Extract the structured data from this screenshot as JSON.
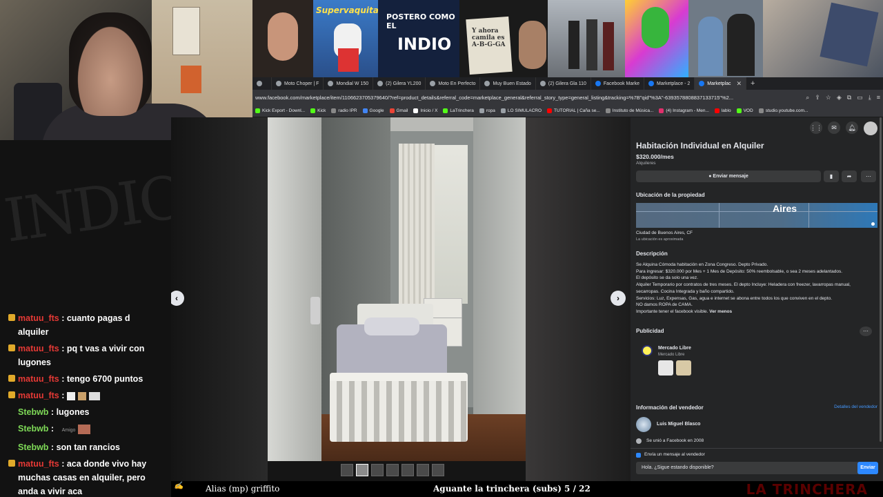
{
  "tabs": [
    {
      "label": "Moto Choper | F"
    },
    {
      "label": "Mondial W 150"
    },
    {
      "label": "(2) Gilera YL200"
    },
    {
      "label": "Moto En Perfecto"
    },
    {
      "label": "Muy Buen Estado"
    },
    {
      "label": "(2) Gilera Gla 110"
    },
    {
      "label": "Facebook Marke"
    },
    {
      "label": "Marketplace - 2"
    },
    {
      "label": "Marketplac"
    }
  ],
  "address_url": "www.facebook.com/marketplace/item/1106623705379640/?ref=product_details&referral_code=marketplace_general&referral_story_type=general_listing&tracking=%7B\"qid\"%3A\"-6393578808837133715\"%2...",
  "bookmarks": [
    "Kick Export - Downl...",
    "Kick",
    "radio IPR",
    "Google",
    "Gmail",
    "Inicio / X",
    "LaTrinchera",
    "ropa",
    "LO SIMULACRO",
    "TUTORIAL | Caña se...",
    "Instituto de Música...",
    "(4) Instagram - Men...",
    "lablo",
    "VOD",
    "studio.youtube.com..."
  ],
  "thumbs": {
    "supervaquita": "Supervaquita",
    "indio": "INDIO",
    "note": "Y ahora camila es A-B-G-GA",
    "posterito": "POSTERO COMO EL"
  },
  "listing": {
    "title": "Habitación Individual en Alquiler",
    "price": "$320.000/mes",
    "category": "Alquileres",
    "send_message": "Enviar mensaje",
    "location_title": "Ubicación de la propiedad",
    "map_label": "Aires",
    "city": "Ciudad de Buenos Aires, CF",
    "approx": "La ubicación es aproximada",
    "description_title": "Descripción",
    "description_lines": [
      "Se Alquina Cómoda habitación en Zona Congreso. Depto Privado.",
      "Para ingresar: $320.000 por Mes + 1 Mes de Depósito: 50% reembolsable, o sea 2 meses adelantados.",
      "El depósito se da solo una vez.",
      "Alquiler Temporario por contratos de tres meses. El depto Incluye: Heladera con freezer, lavarropas manual,",
      "secarropas. Cocina Integrada y baño compartido.",
      "Servicios: Luz, Expensas, Gas, agua e internet se abona entre todos los que conviven en el depto.",
      "NO damos ROPA de CAMA.",
      "Importante tener el facebook visible."
    ],
    "see_less": "Ver menos",
    "ads_title": "Publicidad",
    "ad_name": "Mercado Libre",
    "ad_sub": "Mercado Libre",
    "seller_info_title": "Información del vendedor",
    "seller_details": "Detalles del vendedor",
    "seller_name": "Luis Miguel Blasco",
    "joined": "Se unió a Facebook en 2008",
    "send_to_seller": "Envía un mensaje al vendedor",
    "message_text": "Hola. ¿Sigue estando disponible?",
    "send": "Enviar"
  },
  "chat": [
    {
      "user": "matuu_fts",
      "sep": " : ",
      "text": "cuanto pagas d alquiler",
      "badge": true,
      "green": false
    },
    {
      "user": "matuu_fts",
      "sep": " : ",
      "text": "pq t vas a vivir con lugones",
      "badge": true,
      "green": false
    },
    {
      "user": "matuu_fts",
      "sep": " : ",
      "text": "tengo 6700 puntos",
      "badge": true,
      "green": false
    },
    {
      "user": "matuu_fts",
      "sep": " : ",
      "text": "",
      "badge": true,
      "green": false,
      "emotes": true
    },
    {
      "user": "Stebwb",
      "sep": " : ",
      "text": "lugones",
      "badge": false,
      "green": true
    },
    {
      "user": "Stebwb",
      "sep": " : ",
      "text": "",
      "badge": false,
      "green": true,
      "emote_small": true,
      "emote_text": "Amigo"
    },
    {
      "user": "Stebwb",
      "sep": " : ",
      "text": "son tan rancios",
      "badge": false,
      "green": true
    },
    {
      "user": "matuu_fts",
      "sep": " : ",
      "text": "aca donde vivo hay muchas casas en alquiler, pero anda a vivir aca",
      "badge": true,
      "green": false
    }
  ],
  "bottom": {
    "alias": "Alias (mp) griffito",
    "aguante": "Aguante la trinchera (subs) 5 / 22",
    "logo": "LA TRINCHERA"
  }
}
